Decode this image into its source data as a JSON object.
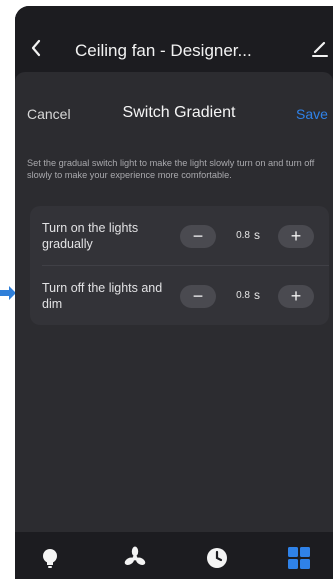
{
  "topbar": {
    "title": "Ceiling fan - Designer...",
    "back_icon": "chevron-left-icon",
    "edit_icon": "pencil-icon"
  },
  "sheet": {
    "cancel_label": "Cancel",
    "title": "Switch Gradient",
    "save_label": "Save",
    "description": "Set the gradual switch light to make the light slowly turn on and turn off slowly to make your experience more comfortable."
  },
  "settings": [
    {
      "label": "Turn on the lights gradually",
      "value": "0.8",
      "unit": "s"
    },
    {
      "label": "Turn off the lights and dim",
      "value": "0.8",
      "unit": "s"
    }
  ],
  "bottom_nav": {
    "items": [
      "lightbulb-icon",
      "fan-icon",
      "clock-icon",
      "grid-icon"
    ],
    "active": "grid-icon"
  },
  "colors": {
    "background": "#1f1f23",
    "sheet": "#2c2c30",
    "card": "#333338",
    "accent": "#2f82e8",
    "arrow": "#2f7fd9"
  }
}
